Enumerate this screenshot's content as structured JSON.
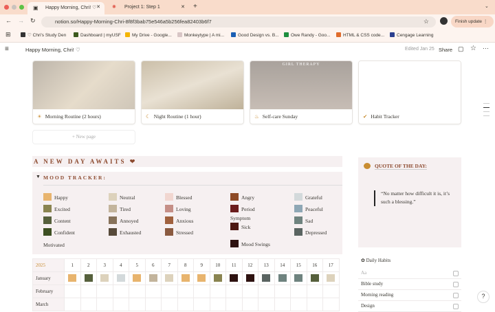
{
  "browser": {
    "tabs": [
      {
        "label": "Happy Morning, Chri! ♡",
        "active": true
      },
      {
        "label": "Project 1: Step 1",
        "active": false
      }
    ],
    "url": "notion.so/Happy-Morning-Chri-8f8f3bab75e546a5b256fea82403b6f7",
    "finish_update": "Finish update",
    "bookmarks": [
      {
        "label": "♡ Chri's Study Den",
        "color": "#333333"
      },
      {
        "label": "Dashboard | myUSF",
        "color": "#3c5a1e"
      },
      {
        "label": "My Drive - Google...",
        "color": "#f4b400"
      },
      {
        "label": "Monkeytype | A mi...",
        "color": "#d8c6c6"
      },
      {
        "label": "Good Design vs. B...",
        "color": "#1a5fb4"
      },
      {
        "label": "Owe Randy - Goo...",
        "color": "#1e8e3e"
      },
      {
        "label": "HTML & CSS code...",
        "color": "#e06c2c"
      },
      {
        "label": "Cengage Learning",
        "color": "#2a3f8f"
      }
    ]
  },
  "notion_header": {
    "title": "Happy Morning, Chri! ♡",
    "edited": "Edited Jan 25",
    "share": "Share"
  },
  "cards": [
    {
      "title": "Morning Routine (2 hours)",
      "icon": "sun-icon",
      "image": "#c9bfb2"
    },
    {
      "title": "Night Routine (1 hour)",
      "icon": "moon-icon",
      "image": "#d8cfc0"
    },
    {
      "title": "Self-care Sunday",
      "icon": "bath-icon",
      "image": "#b8aca4",
      "image_text": "GIRL THERAPY"
    },
    {
      "title": "Habit Tracker",
      "icon": "check-icon",
      "image": "#ffffff"
    }
  ],
  "new_page": "+ New page",
  "heading": "A NEW DAY AWAITS ❤",
  "mood_tracker": {
    "title": "MOOD TRACKER:",
    "moods": [
      {
        "name": "Happy",
        "color": "#e8b46e"
      },
      {
        "name": "Excited",
        "color": "#8a8450"
      },
      {
        "name": "Content",
        "color": "#56603c"
      },
      {
        "name": "Confident",
        "color": "#3d4f22"
      },
      {
        "name": "Neutral",
        "color": "#ddd2bc"
      },
      {
        "name": "Tired",
        "color": "#c3b49c"
      },
      {
        "name": "Annoyed",
        "color": "#87725a"
      },
      {
        "name": "Exhausted",
        "color": "#574a3a"
      },
      {
        "name": "Blessed",
        "color": "#f1d6d0"
      },
      {
        "name": "Loving",
        "color": "#c58f87"
      },
      {
        "name": "Anxious",
        "color": "#a0613e"
      },
      {
        "name": "Stressed",
        "color": "#8a5a40"
      },
      {
        "name": "Angry",
        "color": "#8e4a26"
      },
      {
        "name": "Period",
        "color": "#6b1c1c"
      },
      {
        "name": "Sick",
        "color": "#4e1812"
      },
      {
        "name": "Mood Swings",
        "color": "#2e1210"
      },
      {
        "name": "Grateful",
        "color": "#d3d9db"
      },
      {
        "name": "Peaceful",
        "color": "#8ea7b5"
      },
      {
        "name": "Sad",
        "color": "#6f837f"
      },
      {
        "name": "Depressed",
        "color": "#5a6461"
      }
    ],
    "extra_motivated": "Motivated",
    "extra_symptom": "Symptom"
  },
  "calendar": {
    "year": "2025",
    "days": [
      "1",
      "2",
      "3",
      "4",
      "5",
      "6",
      "7",
      "8",
      "9",
      "10",
      "11",
      "12",
      "13",
      "14",
      "15",
      "16",
      "17"
    ],
    "months": [
      {
        "name": "January",
        "moods": [
          "Happy",
          "Content",
          "Neutral",
          "Grateful",
          "Happy",
          "Tired",
          "Neutral",
          "Happy",
          "Happy",
          "Excited",
          "Mood Swings",
          "Mood Swings",
          "Depressed",
          "Sad",
          "Sad",
          "Content",
          "Neutral"
        ]
      },
      {
        "name": "February",
        "moods": []
      },
      {
        "name": "March",
        "moods": []
      }
    ]
  },
  "quote": {
    "title": "QUOTE OF THE DAY:",
    "text": "“No matter how difficult it is, it’s such a blessing.”"
  },
  "habits": {
    "title": "Daily Habits",
    "header": "Aa",
    "rows": [
      "Bible study",
      "Morning reading",
      "Design"
    ]
  }
}
